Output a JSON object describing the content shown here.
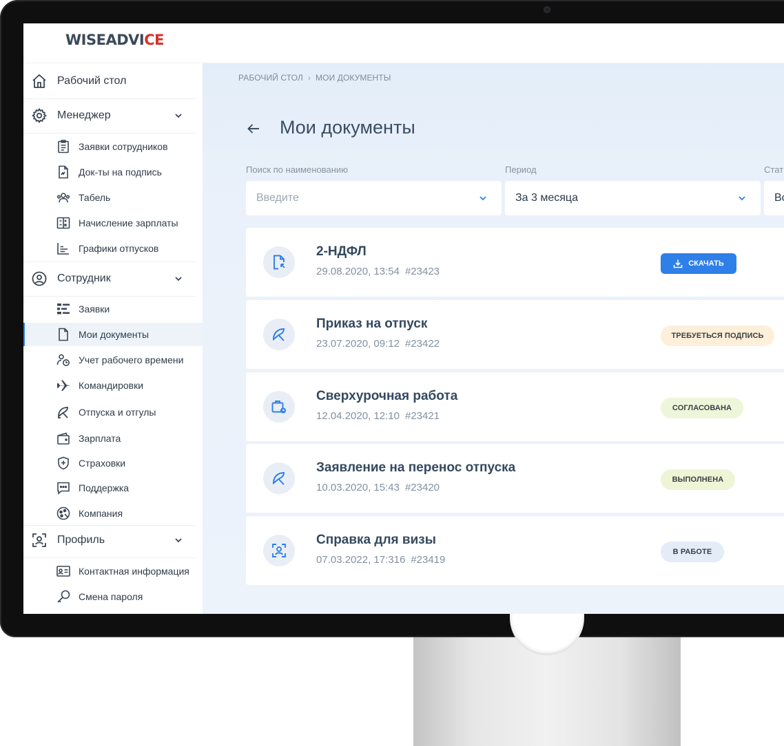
{
  "brand": {
    "logo_main": "WISEADVI",
    "logo_accent": "CE"
  },
  "colors": {
    "accent": "#2f7fe8",
    "sign": "#fdefd9",
    "approved": "#eef6d9",
    "done": "#eef4d6",
    "inwork": "#e4ecf8",
    "brand_red": "#d8312a"
  },
  "sidebar": {
    "desktop": "Рабочий стол",
    "manager": {
      "label": "Менеджер",
      "items": [
        "Заявки сотрудников",
        "Док-ты на подпись",
        "Табель",
        "Начисление зарплаты",
        "Графики отпусков"
      ]
    },
    "employee": {
      "label": "Сотрудник",
      "items": [
        "Заявки",
        "Мои документы",
        "Учет рабочего времени",
        "Командировки",
        "Отпуска и отгулы",
        "Зарплата",
        "Страховки",
        "Поддержка",
        "Компания"
      ]
    },
    "profile": {
      "label": "Профиль",
      "items": [
        "Контактная информация",
        "Смена пароля"
      ]
    }
  },
  "breadcrumb": {
    "home": "РАБОЧИЙ СТОЛ",
    "sep": "›",
    "current": "МОИ ДОКУМЕНТЫ"
  },
  "page": {
    "title": "Мои документы"
  },
  "filters": {
    "search_label": "Поиск по наименованию",
    "search_placeholder": "Введите",
    "period_label": "Период",
    "period_value": "За 3 месяца",
    "status_label": "Стат",
    "status_value": "Вс"
  },
  "documents": [
    {
      "title": "2-НДФЛ",
      "date": "29.08.2020, 13:54",
      "number": "#23423",
      "action": "СКАЧАТЬ",
      "icon": "document-download-icon"
    },
    {
      "title": "Приказ на отпуск",
      "date": "23.07.2020, 09:12",
      "number": "#23422",
      "status": "ТРЕБУЕТЬСЯ ПОДПИСЬ",
      "icon": "beach-umbrella-icon"
    },
    {
      "title": "Сверхурочная работа",
      "date": "12.04.2020, 12:10",
      "number": "#23421",
      "status": "СОГЛАСОВАНА",
      "icon": "briefcase-clock-icon"
    },
    {
      "title": "Заявление на перенос отпуска",
      "date": "10.03.2020, 15:43",
      "number": "#23420",
      "status": "ВЫПОЛНЕНА",
      "icon": "beach-umbrella-icon"
    },
    {
      "title": "Справка для визы",
      "date": "07.03.2022, 17:316",
      "number": "#23419",
      "status": "В РАБОТЕ",
      "icon": "user-scan-icon"
    }
  ]
}
